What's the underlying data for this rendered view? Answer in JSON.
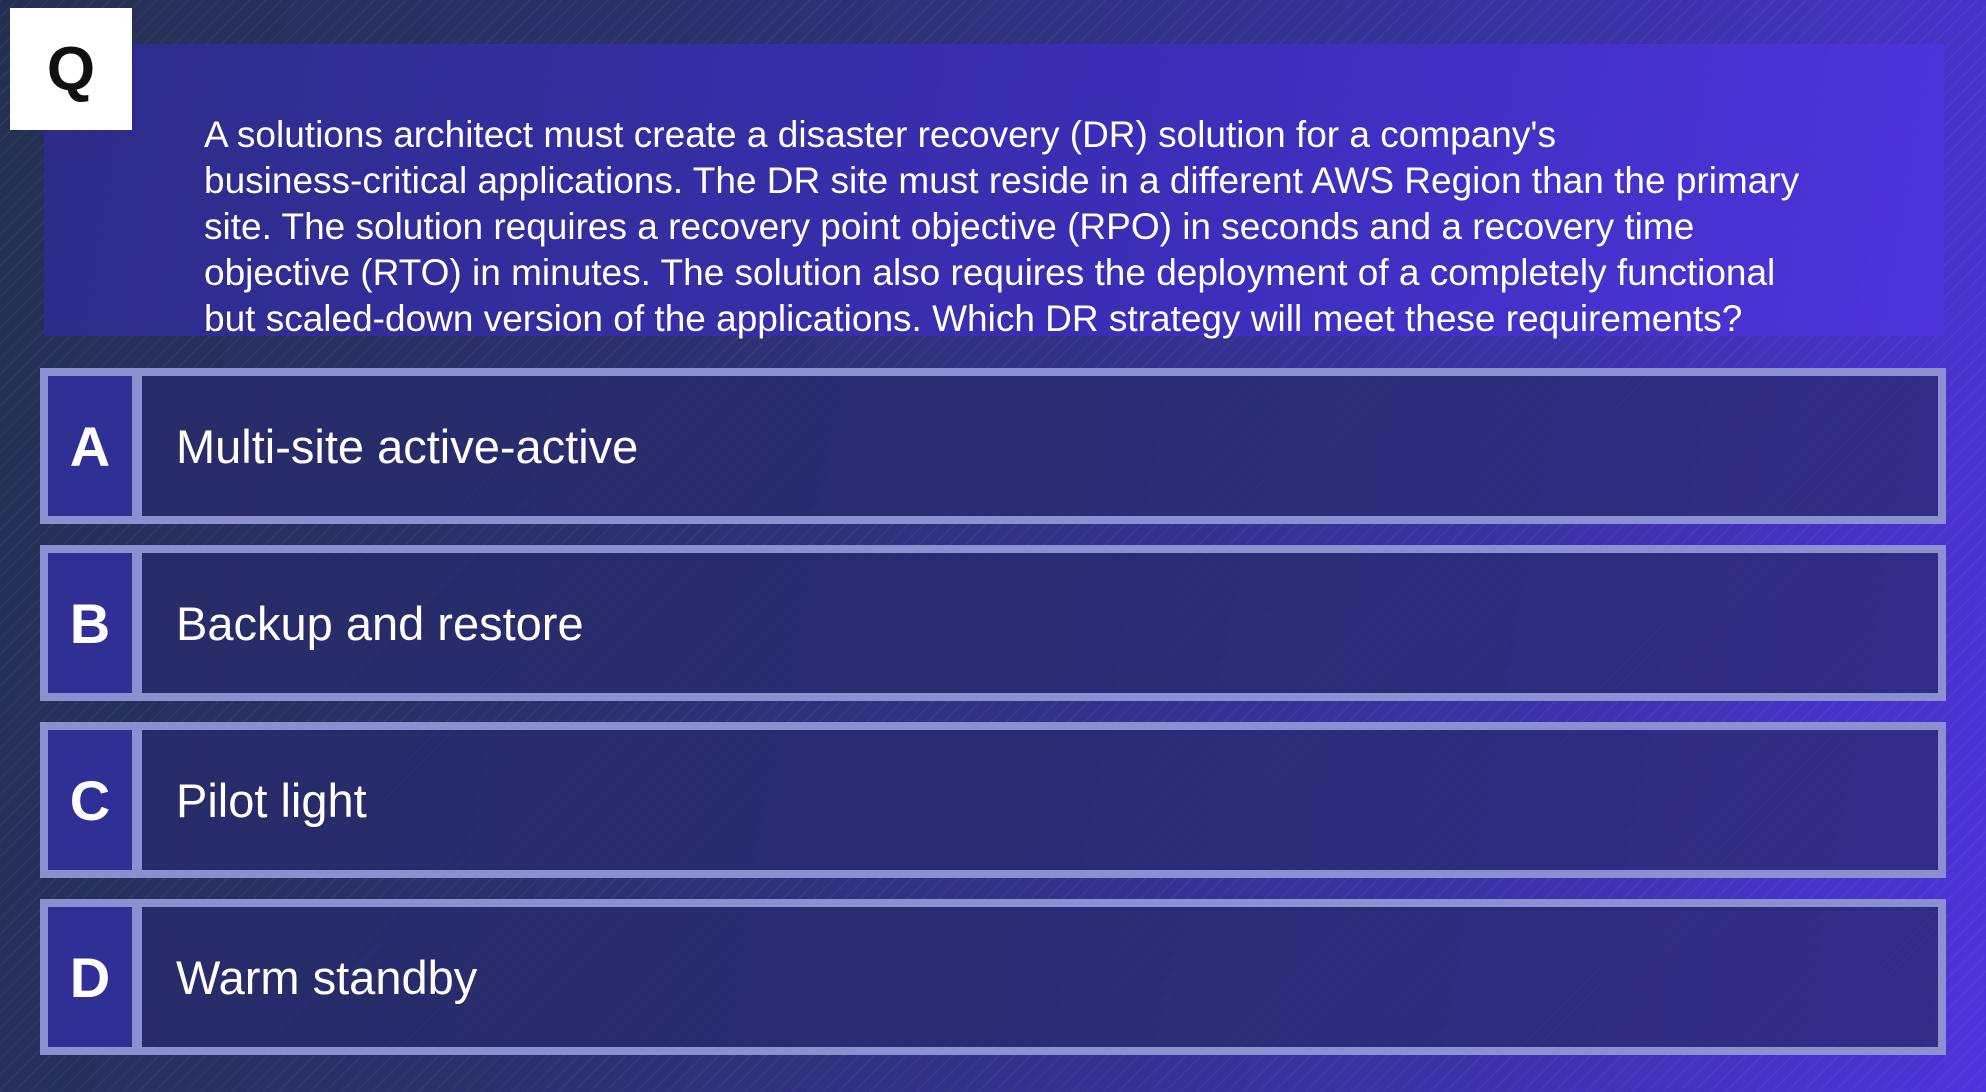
{
  "question": {
    "badge": "Q",
    "lines": [
      "A solutions architect must create a disaster recovery (DR) solution for a company's",
      "business-critical applications. The DR site must reside in a different AWS Region than the primary",
      "site. The solution requires a recovery point objective (RPO) in seconds and a recovery time",
      "objective (RTO) in minutes. The solution also requires the deployment of a completely functional",
      "but scaled-down version of the applications. Which DR strategy will meet these requirements?"
    ]
  },
  "options": [
    {
      "letter": "A",
      "text": "Multi-site active-active"
    },
    {
      "letter": "B",
      "text": "Backup and restore"
    },
    {
      "letter": "C",
      "text": "Pilot light"
    },
    {
      "letter": "D",
      "text": "Warm standby"
    }
  ],
  "colors": {
    "accent": "#8c8fd0",
    "letter_bg": "#2f2f96",
    "badge_bg": "#ffffff"
  }
}
